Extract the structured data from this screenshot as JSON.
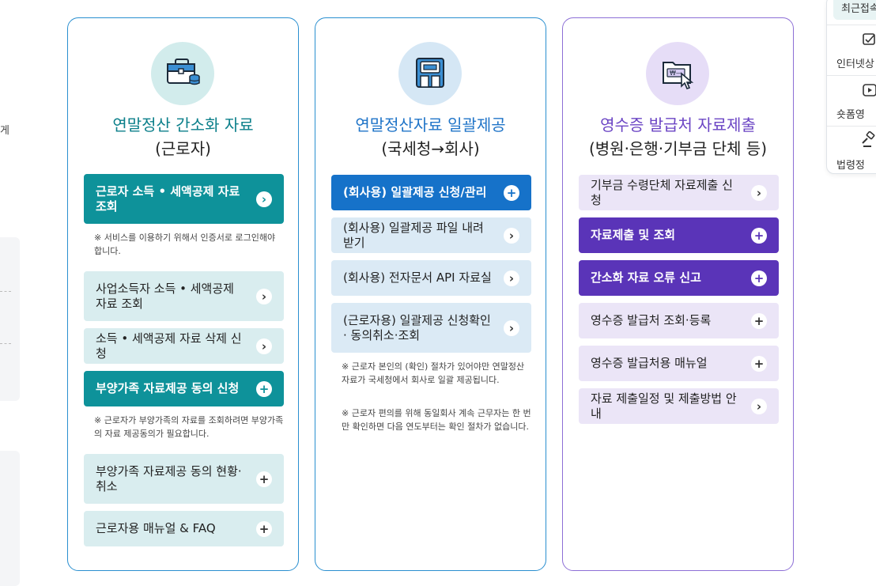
{
  "left_fragments": {
    "char1": "게",
    "char2": "ㅡ"
  },
  "quick_menu": {
    "recent": "최근접속",
    "items": [
      {
        "label": "인터넷상",
        "icon": "checkbox-icon"
      },
      {
        "label": "숏폼영",
        "icon": "play-icon"
      },
      {
        "label": "법령정",
        "icon": "gavel-icon"
      }
    ]
  },
  "cards": [
    {
      "icon": "briefcase-icon",
      "title_line1": "연말정산 간소화 자료",
      "title_line2": "(근로자)",
      "buttons": [
        {
          "label": "근로자 소득 • 세액공제 자료 조회",
          "icon": "chevron-right-icon",
          "style": "teal-solid"
        },
        {
          "label": "사업소득자 소득 • 세액공제 자료 조회",
          "icon": "chevron-right-icon",
          "style": "teal-light"
        },
        {
          "label": "소득 • 세액공제 자료 삭제 신청",
          "icon": "chevron-right-icon",
          "style": "teal-light"
        },
        {
          "label": "부양가족 자료제공 동의 신청",
          "icon": "plus-icon",
          "style": "teal-solid"
        },
        {
          "label": "부양가족 자료제공 동의 현황·취소",
          "icon": "plus-icon",
          "style": "teal-light"
        },
        {
          "label": "근로자용 매뉴얼 & FAQ",
          "icon": "plus-icon",
          "style": "teal-light"
        }
      ],
      "notes": [
        "※ 서비스를 이용하기 위해서 인증서로 로그인해야 합니다.",
        "※ 근로자가 부양가족의 자료를 조회하려면 부양가족의 자료 제공동의가 필요합니다."
      ]
    },
    {
      "icon": "building-icon",
      "title_line1": "연말정산자료 일괄제공",
      "title_line2": "(국세청→회사)",
      "buttons": [
        {
          "label": "(회사용) 일괄제공 신청/관리",
          "icon": "plus-icon",
          "style": "blue-solid"
        },
        {
          "label": "(회사용) 일괄제공 파일 내려받기",
          "icon": "chevron-right-icon",
          "style": "blue-light"
        },
        {
          "label": "(회사용) 전자문서 API 자료실",
          "icon": "chevron-right-icon",
          "style": "blue-light"
        },
        {
          "label": "(근로자용) 일괄제공 신청확인· 동의취소·조회",
          "icon": "chevron-right-icon",
          "style": "blue-light"
        }
      ],
      "notes": [
        "※ 근로자 본인의 (확인) 절차가 있어야만 연말정산 자료가 국세청에서 회사로 일괄 제공됩니다.",
        "※ 근로자 편의를 위해 동일회사 계속 근무자는 한 번만 확인하면 다음 연도부터는 확인 절차가 없습니다."
      ]
    },
    {
      "icon": "receipt-cursor-icon",
      "title_line1": "영수증 발급처 자료제출",
      "title_line2": "(병원·은행·기부금 단체 등)",
      "buttons": [
        {
          "label": "기부금 수령단체 자료제출 신청",
          "icon": "chevron-right-icon",
          "style": "purple-light"
        },
        {
          "label": "자료제출 및 조회",
          "icon": "plus-icon",
          "style": "purple-solid"
        },
        {
          "label": "간소화 자료 오류 신고",
          "icon": "plus-icon",
          "style": "purple-solid"
        },
        {
          "label": "영수증 발급처 조회·등록",
          "icon": "plus-icon",
          "style": "purple-light"
        },
        {
          "label": "영수증 발급처용 매뉴얼",
          "icon": "plus-icon",
          "style": "purple-light"
        },
        {
          "label": "자료 제출일정 및 제출방법 안내",
          "icon": "chevron-right-icon",
          "style": "purple-light"
        }
      ],
      "notes": []
    }
  ],
  "colors": {
    "teal": "#0e929a",
    "blue": "#1672c9",
    "purple": "#5a34b8"
  }
}
